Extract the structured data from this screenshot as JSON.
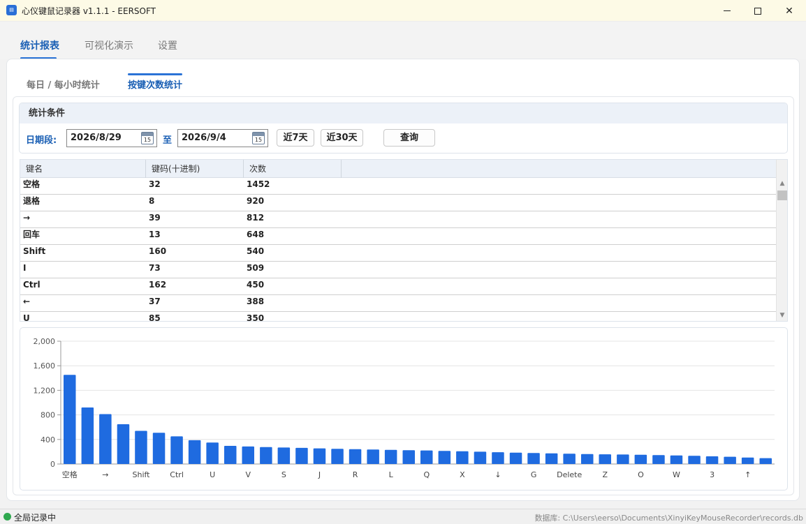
{
  "window": {
    "title": "心仪键鼠记录器 v1.1.1 - EERSOFT",
    "icon": "app-logo-icon",
    "minimize_icon": "minimize-icon",
    "maximize_icon": "maximize-icon",
    "close_icon": "close-icon"
  },
  "main_tabs": [
    {
      "label": "统计报表",
      "active": true
    },
    {
      "label": "可视化演示",
      "active": false
    },
    {
      "label": "设置",
      "active": false
    }
  ],
  "sub_tabs": [
    {
      "label": "每日 / 每小时统计",
      "active": false
    },
    {
      "label": "按键次数统计",
      "active": true
    }
  ],
  "conditions": {
    "title": "统计条件",
    "date_label": "日期段:",
    "start_date": "2026/8/29",
    "to_label": "至",
    "end_date": "2026/9/4",
    "calendar_icon": "calendar-icon",
    "calendar_day": "15",
    "btn_7": "近7天",
    "btn_30": "近30天",
    "btn_query": "查询"
  },
  "table": {
    "columns": [
      "键名",
      "键码(十进制)",
      "次数"
    ],
    "rows": [
      [
        "空格",
        "32",
        "1452"
      ],
      [
        "退格",
        "8",
        "920"
      ],
      [
        "→",
        "39",
        "812"
      ],
      [
        "回车",
        "13",
        "648"
      ],
      [
        "Shift",
        "160",
        "540"
      ],
      [
        "I",
        "73",
        "509"
      ],
      [
        "Ctrl",
        "162",
        "450"
      ],
      [
        "←",
        "37",
        "388"
      ],
      [
        "U",
        "85",
        "350"
      ]
    ]
  },
  "chart_data": {
    "type": "bar",
    "title": "",
    "xlabel": "",
    "ylabel": "",
    "ylim": [
      0,
      2000
    ],
    "yticks": [
      "0",
      "400",
      "800",
      "1,200",
      "1,600",
      "2,000"
    ],
    "grid": true,
    "bar_color": "#1f6be0",
    "categories": [
      "空格",
      "退格",
      "→",
      "回车",
      "Shift",
      "I",
      "Ctrl",
      "←",
      "U",
      "",
      "V",
      "",
      "S",
      "",
      "J",
      "",
      "R",
      "",
      "L",
      "",
      "Q",
      "",
      "X",
      "",
      "↓",
      "",
      "G",
      "",
      "Delete",
      "",
      "Z",
      "",
      "O",
      "",
      "W",
      "",
      "3",
      "",
      "↑",
      ""
    ],
    "x_tick_labels": [
      "空格",
      "→",
      "Shift",
      "Ctrl",
      "U",
      "V",
      "S",
      "J",
      "R",
      "L",
      "Q",
      "X",
      "↓",
      "G",
      "Delete",
      "Z",
      "O",
      "W",
      "3",
      "↑"
    ],
    "values": [
      1452,
      920,
      812,
      648,
      540,
      509,
      450,
      388,
      350,
      295,
      285,
      275,
      268,
      262,
      255,
      248,
      242,
      236,
      230,
      225,
      220,
      214,
      208,
      200,
      192,
      185,
      180,
      174,
      168,
      162,
      158,
      154,
      150,
      145,
      140,
      133,
      125,
      118,
      105,
      95
    ]
  },
  "status": {
    "recording": "全局记录中",
    "db_path": "数据库:  C:\\Users\\eerso\\Documents\\XinyiKeyMouseRecorder\\records.db"
  },
  "colors": {
    "accent": "#1a5fb4",
    "indicator": "#2b73d6",
    "status_dot": "#2fa84f",
    "titlebar": "#fdfae6"
  }
}
